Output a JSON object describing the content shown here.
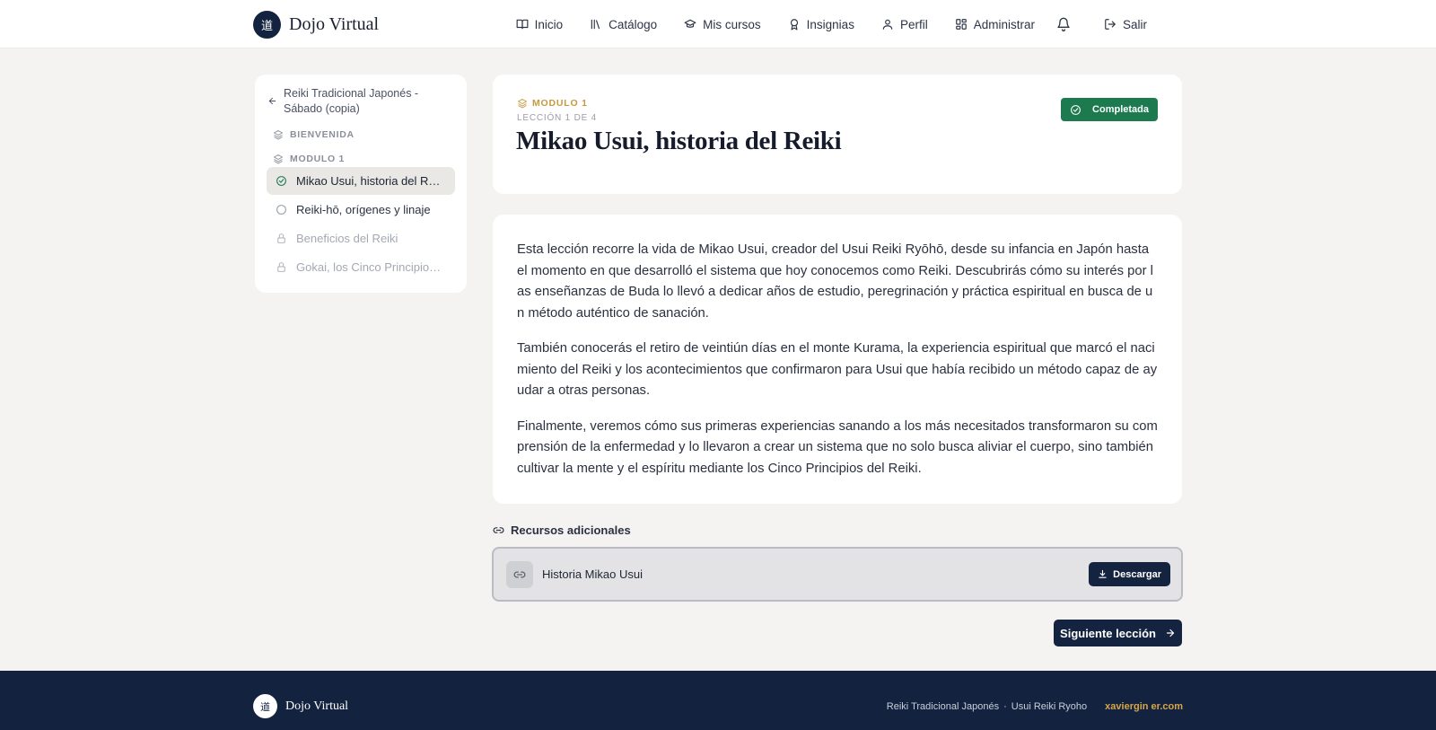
{
  "header": {
    "brand_logo_glyph": "道",
    "brand_name": "Dojo Virtual",
    "nav": {
      "inicio": "Inicio",
      "catalogo": "Catálogo",
      "mis_cursos": "Mis cursos",
      "insignias": "Insignias",
      "perfil": "Perfil",
      "administrar": "Administrar",
      "salir": "Salir"
    },
    "icons": {
      "inicio": "book-open-icon",
      "catalogo": "library-icon",
      "mis_cursos": "graduation-cap-icon",
      "insignias": "award-icon",
      "perfil": "user-icon",
      "administrar": "dashboard-icon",
      "notifications": "bell-icon",
      "salir": "logout-icon"
    }
  },
  "sidebar": {
    "course_title": "Reiki Tradicional Japonés - Sábado (copia)",
    "sections": [
      {
        "label": "BIENVENIDA"
      },
      {
        "label": "MODULO 1"
      }
    ],
    "lessons": [
      {
        "label": "Mikao Usui, historia del Reiki",
        "state": "completed"
      },
      {
        "label": "Reiki-hō, orígenes y linaje",
        "state": "pending"
      },
      {
        "label": "Beneficios del Reiki",
        "state": "locked"
      },
      {
        "label": "Gokai, los Cinco Principios del Reiki",
        "state": "locked"
      }
    ]
  },
  "lesson": {
    "module_label": "MODULO 1",
    "count_label": "LECCIÓN 1 DE 4",
    "title": "Mikao Usui, historia del Reiki",
    "status_badge": "Completada",
    "paragraphs": [
      "Esta lección recorre la vida de Mikao Usui, creador del Usui Reiki Ryōhō, desde su infancia en Japón hasta el momento en que desarrolló el sistema que hoy conocemos como Reiki. Descubrirás cómo su interés por las enseñanzas de Buda lo llevó a dedicar años de estudio, peregrinación y práctica espiritual en busca de un método auténtico de sanación.",
      "También conocerás el retiro de veintiún días en el monte Kurama, la experiencia espiritual que marcó el nacimiento del Reiki y los acontecimientos que confirmaron para Usui que había recibido un método capaz de ayudar a otras personas.",
      "Finalmente, veremos cómo sus primeras experiencias sanando a los más necesitados transformaron su comprensión de la enfermedad y lo llevaron a crear un sistema que no solo busca aliviar el cuerpo, sino también cultivar la mente y el espíritu mediante los Cinco Principios del Reiki."
    ]
  },
  "resources": {
    "title": "Recursos adicionales",
    "items": [
      {
        "name": "Historia Mikao Usui",
        "action_label": "Descargar"
      }
    ]
  },
  "next_button": "Siguiente lección",
  "footer": {
    "brand_logo_glyph": "道",
    "brand_name": "Dojo Virtual",
    "tag_1": "Reiki Tradicional Japonés",
    "separator": "·",
    "tag_2": "Usui Reiki Ryoho",
    "link": "xaviergin er.com"
  },
  "colors": {
    "navy": "#13233f",
    "gold": "#c69a3f",
    "success": "#1d7a4f",
    "background": "#f4f3f1"
  }
}
